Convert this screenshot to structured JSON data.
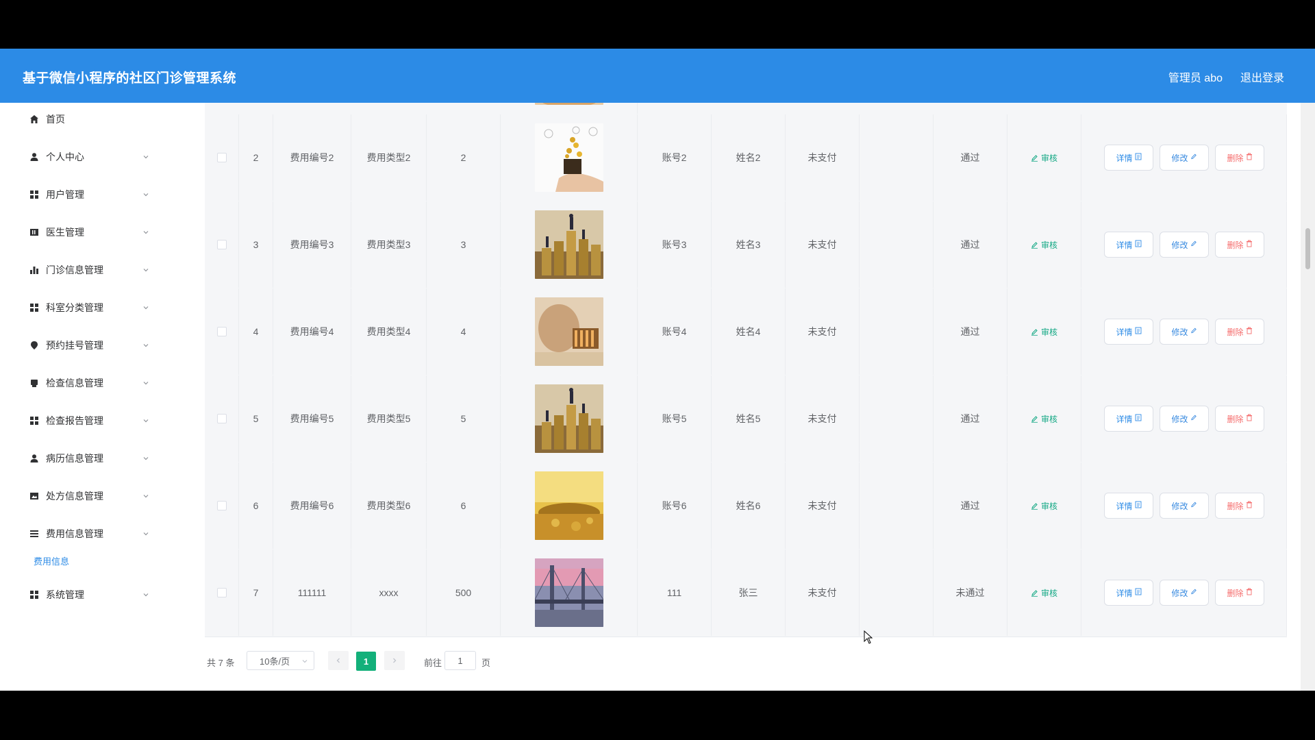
{
  "header": {
    "title": "基于微信小程序的社区门诊管理系统",
    "admin": "管理员 abo",
    "logout": "退出登录"
  },
  "sidebar": {
    "items": [
      {
        "label": "首页",
        "icon": "home-icon"
      },
      {
        "label": "个人中心",
        "icon": "user-icon"
      },
      {
        "label": "用户管理",
        "icon": "grid-icon"
      },
      {
        "label": "医生管理",
        "icon": "book-icon"
      },
      {
        "label": "门诊信息管理",
        "icon": "bar-chart-icon"
      },
      {
        "label": "科室分类管理",
        "icon": "grid-icon"
      },
      {
        "label": "预约挂号管理",
        "icon": "location-icon"
      },
      {
        "label": "检查信息管理",
        "icon": "printer-icon"
      },
      {
        "label": "检查报告管理",
        "icon": "grid-icon"
      },
      {
        "label": "病历信息管理",
        "icon": "user-icon"
      },
      {
        "label": "处方信息管理",
        "icon": "picture-icon"
      },
      {
        "label": "费用信息管理",
        "icon": "menu-icon"
      },
      {
        "label": "系统管理",
        "icon": "grid-icon"
      }
    ],
    "subitem": "费用信息"
  },
  "table": {
    "rows": [
      {
        "idx": "2",
        "code": "费用编号2",
        "type": "费用类型2",
        "amount": "2",
        "account": "账号2",
        "name": "姓名2",
        "pay": "未支付",
        "status": "通过",
        "img": "coins-hand"
      },
      {
        "idx": "3",
        "code": "费用编号3",
        "type": "费用类型3",
        "amount": "3",
        "account": "账号3",
        "name": "姓名3",
        "pay": "未支付",
        "status": "通过",
        "img": "coins-stack"
      },
      {
        "idx": "4",
        "code": "费用编号4",
        "type": "费用类型4",
        "amount": "4",
        "account": "账号4",
        "name": "姓名4",
        "pay": "未支付",
        "status": "通过",
        "img": "abacus"
      },
      {
        "idx": "5",
        "code": "费用编号5",
        "type": "费用类型5",
        "amount": "5",
        "account": "账号5",
        "name": "姓名5",
        "pay": "未支付",
        "status": "通过",
        "img": "coins-stack"
      },
      {
        "idx": "6",
        "code": "费用编号6",
        "type": "费用类型6",
        "amount": "6",
        "account": "账号6",
        "name": "姓名6",
        "pay": "未支付",
        "status": "通过",
        "img": "gold"
      },
      {
        "idx": "7",
        "code": "111111",
        "type": "xxxx",
        "amount": "500",
        "account": "111",
        "name": "张三",
        "pay": "未支付",
        "status": "未通过",
        "img": "bridge"
      }
    ],
    "audit_label": "审核",
    "detail_label": "详情",
    "edit_label": "修改",
    "delete_label": "删除"
  },
  "pagination": {
    "total": "共 7 条",
    "page_size": "10条/页",
    "current": "1",
    "goto_prefix": "前往",
    "goto_value": "1",
    "goto_suffix": "页"
  },
  "colors": {
    "header": "#2c8be6",
    "audit": "#13a884",
    "active_page": "#13b07a",
    "delete": "#f56c6c"
  }
}
